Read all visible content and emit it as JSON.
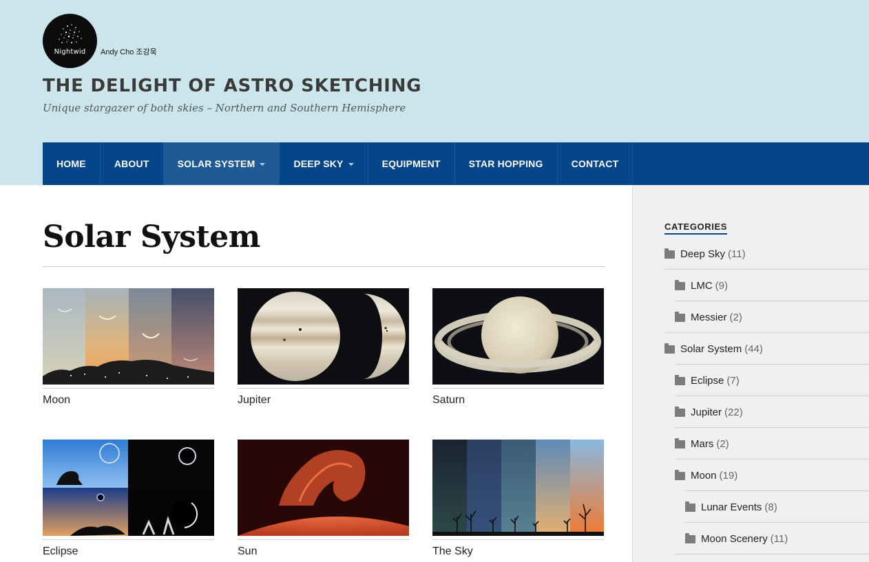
{
  "site": {
    "logo_text": "Nightwid",
    "author": "Andy Cho 조강욱",
    "title": "THE DELIGHT OF ASTRO SKETCHING",
    "tagline": "Unique stargazer of both skies – Northern and Southern Hemisphere"
  },
  "nav": {
    "items": [
      {
        "label": "HOME"
      },
      {
        "label": "ABOUT"
      },
      {
        "label": "SOLAR SYSTEM"
      },
      {
        "label": "DEEP SKY"
      },
      {
        "label": "EQUIPMENT"
      },
      {
        "label": "STAR HOPPING"
      },
      {
        "label": "CONTACT"
      }
    ]
  },
  "main": {
    "title": "Solar System",
    "cards": [
      {
        "label": "Moon"
      },
      {
        "label": "Jupiter"
      },
      {
        "label": "Saturn"
      },
      {
        "label": "Eclipse"
      },
      {
        "label": "Sun"
      },
      {
        "label": "The Sky"
      }
    ]
  },
  "sidebar": {
    "heading": "CATEGORIES",
    "categories": [
      {
        "name": "Deep Sky",
        "count": "(11)"
      },
      {
        "name": "LMC",
        "count": "(9)"
      },
      {
        "name": "Messier",
        "count": "(2)"
      },
      {
        "name": "Solar System",
        "count": "(44)"
      },
      {
        "name": "Eclipse",
        "count": "(7)"
      },
      {
        "name": "Jupiter",
        "count": "(22)"
      },
      {
        "name": "Mars",
        "count": "(2)"
      },
      {
        "name": "Moon",
        "count": "(19)"
      },
      {
        "name": "Lunar Events",
        "count": "(8)"
      },
      {
        "name": "Moon Scenery",
        "count": "(11)"
      }
    ]
  },
  "colors": {
    "header_bg": "#cae6ec",
    "nav_bg": "#05468a",
    "nav_active": "#1f5a96",
    "sidebar_bg": "#f0f0f0"
  }
}
